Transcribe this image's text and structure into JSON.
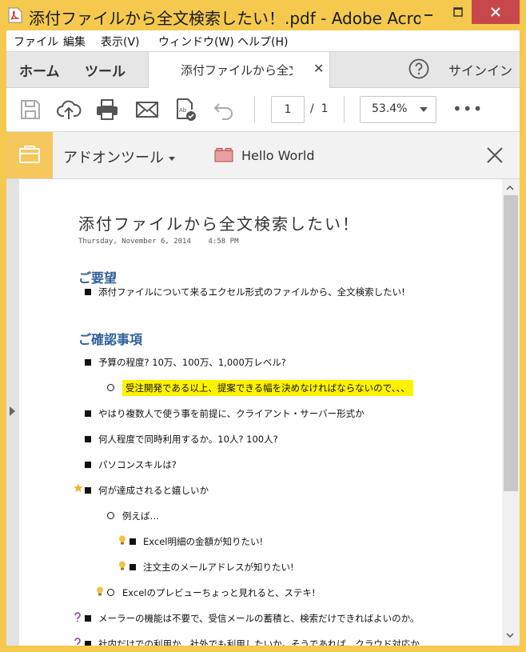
{
  "window": {
    "title": "添付ファイルから全文検索したい！.pdf - Adobe Acrobat ..."
  },
  "menu": [
    "ファイル",
    "編集",
    "表示(V)",
    "ウィンドウ(W)",
    "ヘルプ(H)"
  ],
  "tabs": {
    "home": "ホーム",
    "tools": "ツール",
    "document": "添付ファイルから全文...",
    "signin": "サインイン"
  },
  "toolbar": {
    "page_current": "1",
    "page_sep": "/",
    "page_total": "1",
    "zoom": "53.4%",
    "more": "•••"
  },
  "addon": {
    "title": "アドオンツール",
    "hello": "Hello World"
  },
  "doc": {
    "title": "添付ファイルから全文検索したい！",
    "date": "Thursday, November 6, 2014    4:58 PM",
    "section1": "ご要望",
    "s1_items": [
      "添付ファイルについて来るエクセル形式のファイルから、全文検索したい!"
    ],
    "section2": "ご確認事項",
    "s2_items": [
      "予算の程度? 10万、100万、1,000万レベル?",
      "受注開発である以上、提案できる幅を決めなければならないので、、、",
      "やはり複数人で使う事を前提に、クライアント・サーバー形式か",
      "何人程度で同時利用するか。10人? 100人?",
      "パソコンスキルは?",
      "何が達成されると嬉しいか",
      "例えば…",
      "Excel明細の金額が知りたい!",
      "注文主のメールアドレスが知りたい!",
      "Excelのプレビューちょっと見れると、ステキ!",
      "メーラーの機能は不要で、受信メールの蓄積と、検索だけできればよいのか。",
      "社内だけでの利用か、社外でも利用したいか。そうであれば、クラウド対応か"
    ]
  },
  "colors": {
    "titlebar": "#f4c94e",
    "heading": "#2f5f9b",
    "highlight": "#fff200",
    "close_button": "#c7474d"
  }
}
